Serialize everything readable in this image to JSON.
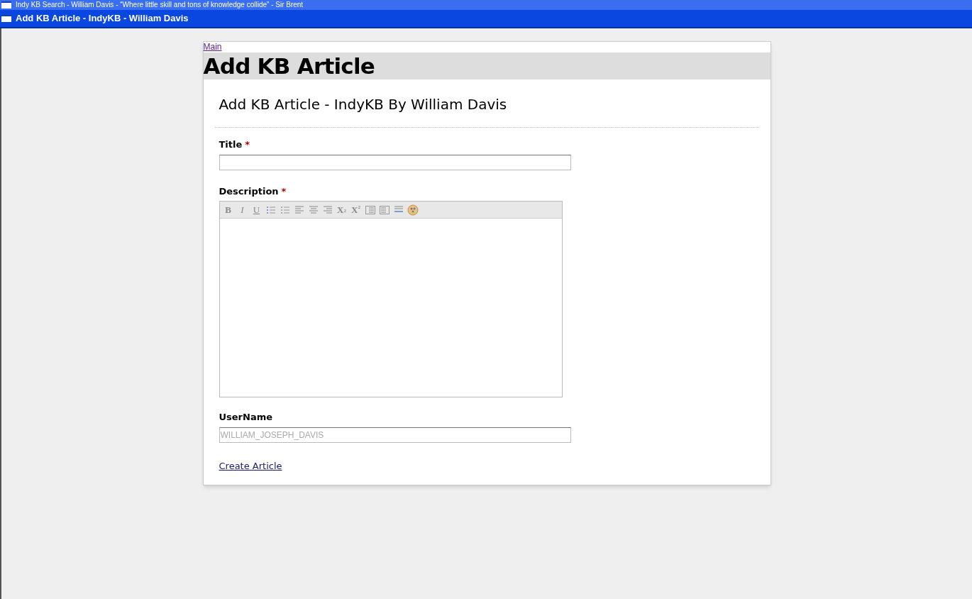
{
  "windows": [
    {
      "title": "Indy KB Search - William Davis - “Where little skill and tons of knowledge collide” - Sir Brent",
      "active": false
    },
    {
      "title": "Add KB Article - IndyKB - William Davis",
      "active": true
    }
  ],
  "breadcrumb": "Main",
  "page_heading": "Add KB Article",
  "form": {
    "title": "Add KB Article - IndyKB By William Davis",
    "fields": [
      {
        "kind": "text",
        "label": "Title",
        "required_mark": "*"
      },
      {
        "kind": "editor",
        "label": "Description",
        "required_mark": "*",
        "toolbar": [
          {
            "kind": "bold",
            "label": "B"
          },
          {
            "kind": "italic",
            "label": "I"
          },
          {
            "kind": "underline",
            "label": "U"
          },
          {
            "kind": "ol"
          },
          {
            "kind": "ul"
          },
          {
            "kind": "left"
          },
          {
            "kind": "center"
          },
          {
            "kind": "right"
          },
          {
            "kind": "sub",
            "label": "X",
            "index": "2"
          },
          {
            "kind": "sup",
            "label": "X",
            "index": "2"
          },
          {
            "kind": "outdent"
          },
          {
            "kind": "indent"
          },
          {
            "kind": "rule"
          },
          {
            "kind": "color"
          }
        ]
      },
      {
        "kind": "text",
        "label": "UserName",
        "value": "WILLIAM_JOSEPH_DAVIS",
        "disabled": true
      }
    ],
    "submit": "Create Article"
  }
}
